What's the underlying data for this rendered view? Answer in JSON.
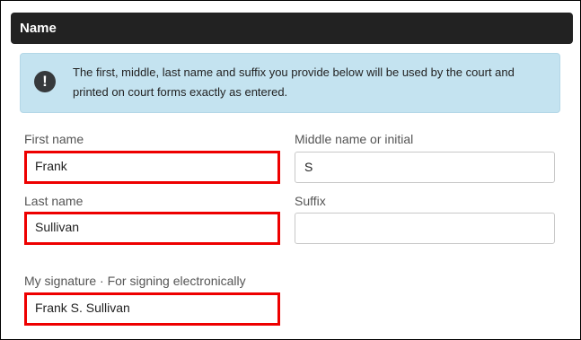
{
  "section": {
    "title": "Name"
  },
  "notice": {
    "icon": "exclamation-circle-icon",
    "text": "The first, middle, last name and suffix you provide below will be used by the court and printed on court forms exactly as entered."
  },
  "form": {
    "first_name": {
      "label": "First name",
      "value": "Frank"
    },
    "middle_name": {
      "label": "Middle name or initial",
      "value": "S"
    },
    "last_name": {
      "label": "Last name",
      "value": "Sullivan"
    },
    "suffix": {
      "label": "Suffix",
      "value": ""
    },
    "signature": {
      "label": "My signature · For signing electronically",
      "value": "Frank S. Sullivan"
    }
  },
  "colors": {
    "header_bg": "#222222",
    "notice_bg": "#c4e3f0",
    "highlight": "#ee0000"
  }
}
